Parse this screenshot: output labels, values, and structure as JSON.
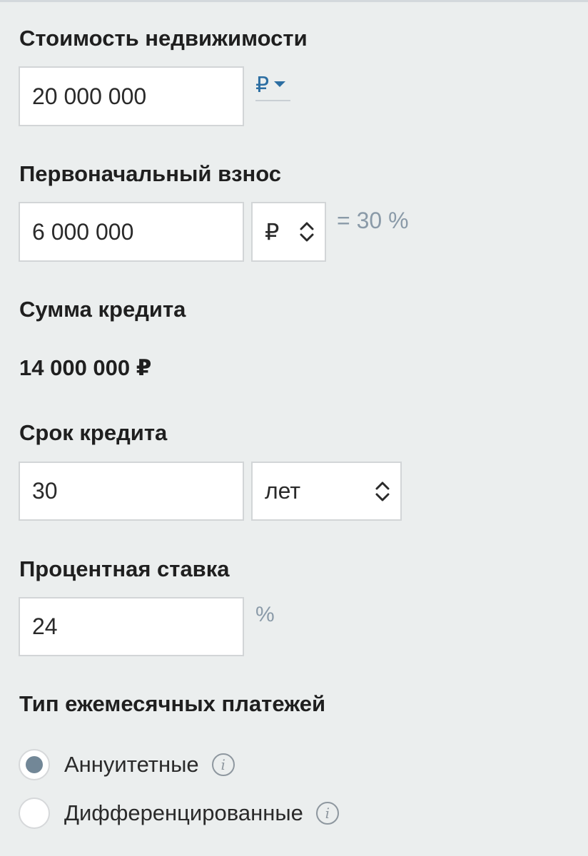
{
  "property_cost": {
    "label": "Стоимость недвижимости",
    "value": "20 000 000",
    "currency": "₽"
  },
  "down_payment": {
    "label": "Первоначальный взнос",
    "value": "6 000 000",
    "unit": "₽",
    "percent_text": "= 30 %"
  },
  "loan_amount": {
    "label": "Сумма кредита",
    "value": "14 000 000 ₽"
  },
  "loan_term": {
    "label": "Срок кредита",
    "value": "30",
    "unit": "лет"
  },
  "interest_rate": {
    "label": "Процентная ставка",
    "value": "24",
    "unit": "%"
  },
  "payment_type": {
    "label": "Тип ежемесячных платежей",
    "options": [
      {
        "label": "Аннуитетные",
        "selected": true
      },
      {
        "label": "Дифференцированные",
        "selected": false
      }
    ]
  },
  "colors": {
    "background": "#ebeeee",
    "link": "#2c6ea2",
    "muted": "#8a9aa8",
    "radio_selected": "#728797"
  },
  "icons": {
    "select_arrows": "chevron-up-down-icon",
    "currency_dropdown": "triangle-down-icon",
    "info": "info-icon"
  }
}
